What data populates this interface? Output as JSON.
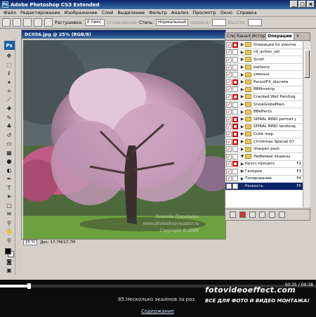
{
  "window": {
    "title": "Adobe Photoshop CS3 Extended",
    "controls": [
      "_",
      "□",
      "x"
    ]
  },
  "menu": [
    "Файл",
    "Редактирование",
    "Изображение",
    "Слой",
    "Выделение",
    "Фильтр",
    "Анализ",
    "Просмотр",
    "Окно",
    "Справка"
  ],
  "options": {
    "feather_label": "Растушевка:",
    "feather_value": "0 пикс.",
    "antialias_label": "Сглаживание",
    "style_label": "Стиль:",
    "style_value": "Нормальный",
    "width_label": "Ширина:",
    "height_label": "Высота:"
  },
  "document": {
    "title": "DC056.jpg @ 25% (RGB/8)",
    "zoom": "25 %",
    "doc_size": "Док: 17,7M/17,7M"
  },
  "panel": {
    "tabs": [
      "Слои",
      "Каналы",
      "История",
      "Операции"
    ],
    "active_tab": "Операции",
    "rows": [
      {
        "label": "Операции по умолчанию",
        "key": "",
        "check": true,
        "toggle": true,
        "expanded": false,
        "folder": true
      },
      {
        "label": "nil_action_set",
        "key": "",
        "check": true,
        "toggle": false,
        "expanded": false,
        "folder": true
      },
      {
        "label": "Scroll",
        "key": "",
        "check": true,
        "toggle": false,
        "expanded": false,
        "folder": true
      },
      {
        "label": "balloonz",
        "key": "",
        "check": true,
        "toggle": false,
        "expanded": false,
        "folder": true
      },
      {
        "label": "уменьш",
        "key": "",
        "check": true,
        "toggle": false,
        "expanded": false,
        "folder": true
      },
      {
        "label": "PanoslFX_discrete",
        "key": "",
        "check": true,
        "toggle": true,
        "expanded": false,
        "folder": true
      },
      {
        "label": "BBfilmstrip",
        "key": "",
        "check": true,
        "toggle": false,
        "expanded": false,
        "folder": true
      },
      {
        "label": "Cracked Wall Paintings",
        "key": "",
        "check": true,
        "toggle": true,
        "expanded": false,
        "folder": true
      },
      {
        "label": "SnowGlobeMain",
        "key": "",
        "check": true,
        "toggle": false,
        "expanded": false,
        "folder": true
      },
      {
        "label": "BBeffects",
        "key": "",
        "check": true,
        "toggle": false,
        "expanded": false,
        "folder": true
      },
      {
        "label": "SPIRAL BIND portrait photos",
        "key": "",
        "check": true,
        "toggle": true,
        "expanded": false,
        "folder": true
      },
      {
        "label": "SPIRAL BIND landscape ph...",
        "key": "",
        "check": true,
        "toggle": true,
        "expanded": false,
        "folder": true
      },
      {
        "label": "Cube map",
        "key": "",
        "check": true,
        "toggle": true,
        "expanded": false,
        "folder": true
      },
      {
        "label": "Christmas Special 07",
        "key": "",
        "check": true,
        "toggle": true,
        "expanded": false,
        "folder": true
      },
      {
        "label": "sharpen pack",
        "key": "",
        "check": true,
        "toggle": false,
        "expanded": false,
        "folder": true
      },
      {
        "label": "Любимые экшены",
        "key": "",
        "check": true,
        "toggle": false,
        "expanded": true,
        "folder": true
      },
      {
        "label": "Кросс-процесс",
        "key": "F2",
        "check": true,
        "toggle": true,
        "expanded": false,
        "folder": false
      },
      {
        "label": "Галерея",
        "key": "F3",
        "check": true,
        "toggle": false,
        "expanded": false,
        "folder": false
      },
      {
        "label": "Тонирование",
        "key": "F4",
        "check": true,
        "toggle": false,
        "expanded": false,
        "folder": false
      },
      {
        "label": "Резкость",
        "key": "F5",
        "check": false,
        "toggle": false,
        "expanded": true,
        "folder": false,
        "selected": true
      }
    ]
  },
  "watermark": {
    "line1": "Зинаида Лукьянова",
    "line2": "www.photoshop-master.ru",
    "line3": "Copyright © 2009"
  },
  "player": {
    "time": "00:35 / 09:38",
    "progress": 0.09,
    "lesson": "85.Несколько экшенов за раз",
    "contents": "Содержание",
    "brand": "fotovideoeffect.com",
    "slogan": "ВСЕ ДЛЯ ФОТО И ВИДЕО МОНТАЖА!"
  }
}
